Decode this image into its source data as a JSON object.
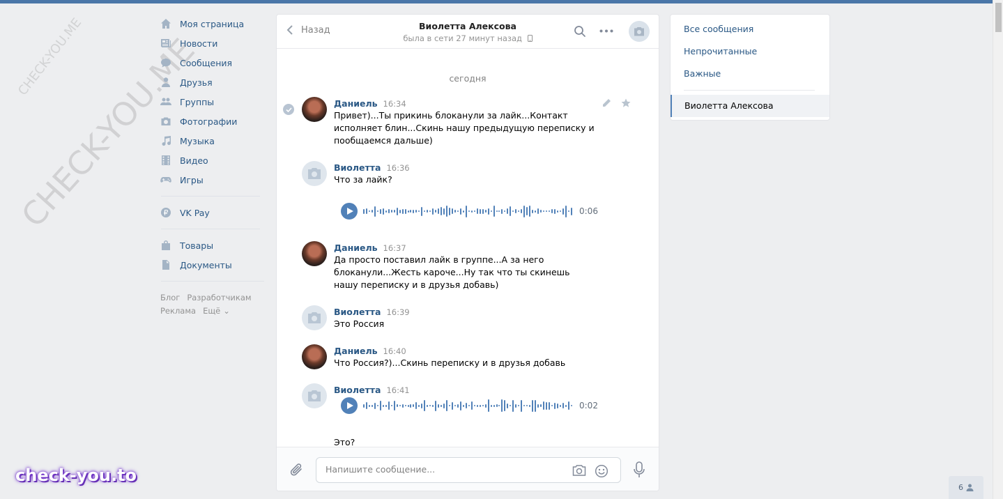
{
  "nav": {
    "items": [
      {
        "label": "Моя страница",
        "icon": "home-icon"
      },
      {
        "label": "Новости",
        "icon": "news-icon"
      },
      {
        "label": "Сообщения",
        "icon": "messages-icon"
      },
      {
        "label": "Друзья",
        "icon": "friends-icon"
      },
      {
        "label": "Группы",
        "icon": "groups-icon"
      },
      {
        "label": "Фотографии",
        "icon": "camera-icon"
      },
      {
        "label": "Музыка",
        "icon": "music-icon"
      },
      {
        "label": "Видео",
        "icon": "video-icon"
      },
      {
        "label": "Игры",
        "icon": "games-icon"
      }
    ],
    "vkpay": "VK Pay",
    "goods": "Товары",
    "docs": "Документы",
    "footer": {
      "blog": "Блог",
      "dev": "Разработчикам",
      "ads": "Реклама",
      "more": "Ещё"
    }
  },
  "chat": {
    "back_label": "Назад",
    "peer_name": "Виолетта Алексова",
    "peer_status": "была в сети 27 минут назад",
    "date_label": "сегодня",
    "messages": [
      {
        "author": "Даниель",
        "time": "16:34",
        "text": "Привет)...Ты прикинь блоканули за лайк...Контакт исполняет блин...Скинь нашу предыдущую переписку и пообщаемся дальше)"
      },
      {
        "author": "Виолетта",
        "time": "16:36",
        "text": "Что за лайк?",
        "voice_duration": "0:06"
      },
      {
        "author": "Даниель",
        "time": "16:37",
        "text": "Да просто поставил лайк в группе...А за него блоканули...Жесть кароче...Ну так что ты скинешь нашу переписку и в друзья добавь)"
      },
      {
        "author": "Виолетта",
        "time": "16:39",
        "text": "Это Россия"
      },
      {
        "author": "Даниель",
        "time": "16:40",
        "text": "Что Россия?)...Скинь переписку и в друзья добавь"
      },
      {
        "author": "Виолетта",
        "time": "16:41",
        "voice_duration": "0:02",
        "text_after": "Это?"
      }
    ],
    "composer_placeholder": "Напишите сообщение..."
  },
  "rightnav": {
    "all": "Все сообщения",
    "unread": "Непрочитанные",
    "important": "Важные",
    "active_dialog": "Виолетта Алексова"
  },
  "online_count": "6",
  "watermark": {
    "small": "CHECK-YOU.ME",
    "large": "CHECK-YOU.ME",
    "brand": "check-you.to"
  },
  "colors": {
    "accent": "#4a76a8",
    "link": "#2a5885",
    "play": "#5181b8"
  }
}
